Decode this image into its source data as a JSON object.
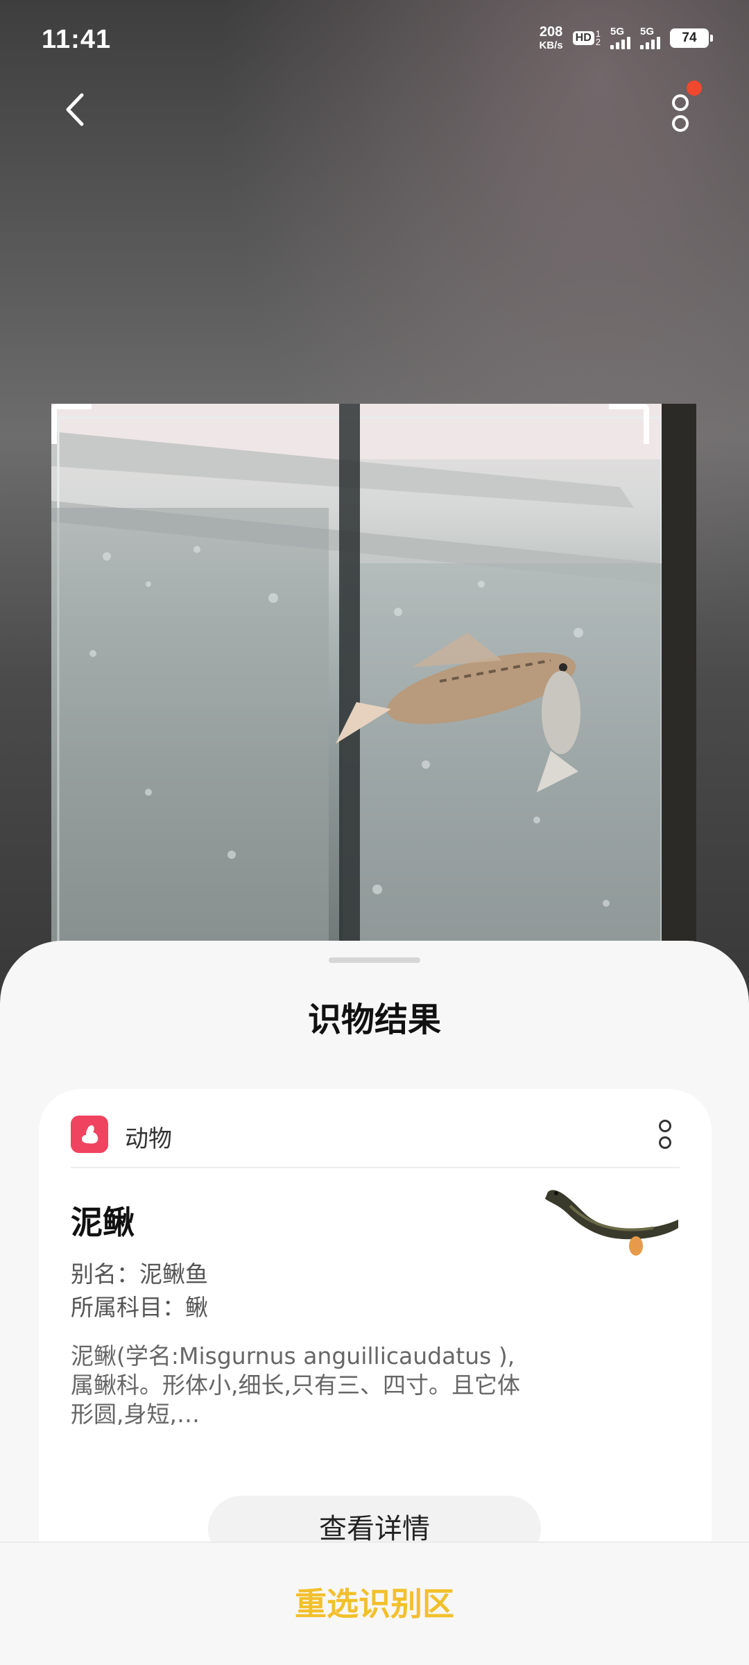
{
  "status_bar": {
    "time": "11:41",
    "net_speed_value": "208",
    "net_speed_unit": "KB/s",
    "hd_label": "HD",
    "hd_sub1": "1",
    "hd_sub2": "2",
    "sim1_label": "5G",
    "sim2_label": "5G",
    "battery": "74"
  },
  "top_nav": {
    "back_icon": "chevron-left-icon",
    "more_icon": "more-vertical-icon",
    "notification_color": "#f0472f"
  },
  "sheet": {
    "title": "识物结果",
    "card": {
      "category_icon": "rabbit-icon",
      "category_color": "#f04360",
      "category": "动物",
      "name": "泥鳅",
      "alias": "别名：泥鳅鱼",
      "family": "所属科目：鳅",
      "description": "泥鳅(学名:Misgurnus anguillicaudatus ),属鳅科。形体小,细长,只有三、四寸。且它体形圆,身短,…",
      "detail_button": "查看详情"
    },
    "reselect_button": "重选识别区",
    "accent_color": "#f2c02c"
  }
}
